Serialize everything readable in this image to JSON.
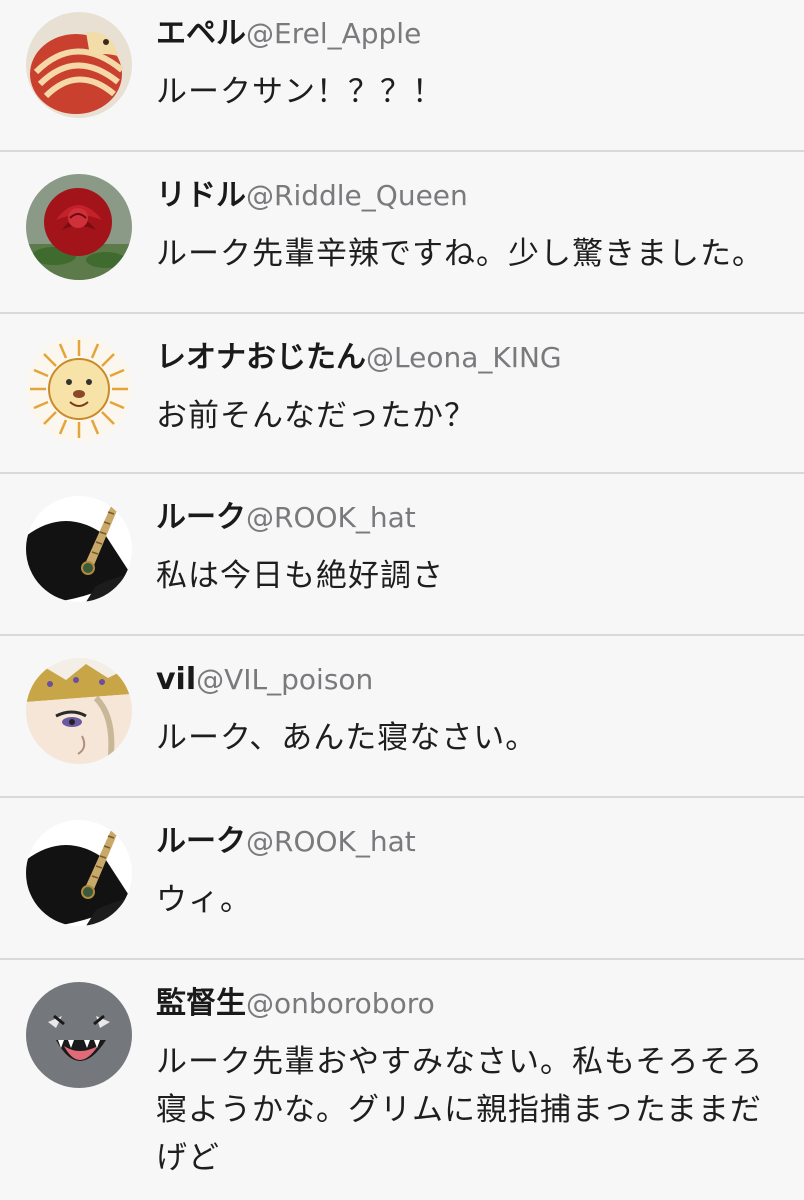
{
  "posts": [
    {
      "name": "エペル",
      "handle": "@Erel_Apple",
      "text": "ルークサン！？？！",
      "avatar_icon": "apple-carving-icon"
    },
    {
      "name": "リドル",
      "handle": "@Riddle_Queen",
      "text": "ルーク先輩辛辣ですね。少し驚きました。",
      "avatar_icon": "red-rose-icon"
    },
    {
      "name": "レオナおじたん",
      "handle": "@Leona_KING",
      "text": "お前そんなだったか？",
      "avatar_icon": "lion-drawing-icon"
    },
    {
      "name": "ルーク",
      "handle": "@ROOK_hat",
      "text": "私は今日も絶好調さ",
      "avatar_icon": "feathered-hat-icon"
    },
    {
      "name": "vil",
      "handle": "@VIL_poison",
      "text": "ルーク、あんた寝なさい。",
      "avatar_icon": "crowned-face-icon"
    },
    {
      "name": "ルーク",
      "handle": "@ROOK_hat",
      "text": "ウィ。",
      "avatar_icon": "feathered-hat-icon"
    },
    {
      "name": "監督生",
      "handle": "@onboroboro",
      "text": "ルーク先輩おやすみなさい。私もそろそろ寝ようかな。グリムに親指捕まったままだげど",
      "avatar_icon": "grinning-ghost-icon"
    }
  ],
  "colors": {
    "background": "#f7f7f8",
    "divider": "#d9d9db",
    "name": "#1a1a1a",
    "handle": "#7a7a7d",
    "text": "#1e1e1e"
  }
}
